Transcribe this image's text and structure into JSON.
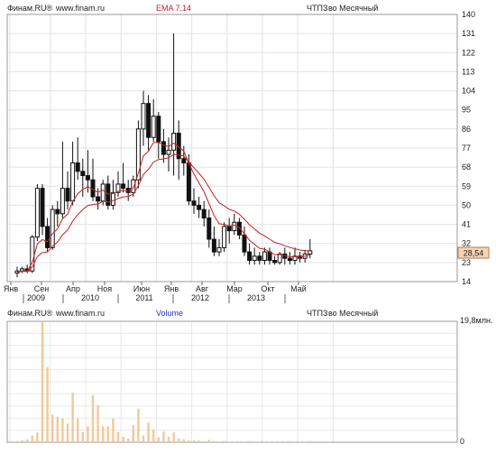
{
  "chart_data": [
    {
      "type": "candlestick",
      "header": {
        "source": "Финам.RU®",
        "site": "www.finam.ru",
        "indicator": "EMA 7,14",
        "instrument": "ЧТПЗ",
        "period": "во Месячный"
      },
      "y_axis": {
        "ticks": [
          14,
          23,
          32,
          41,
          50,
          59,
          68,
          77,
          86,
          95,
          104,
          113,
          122,
          131,
          140
        ],
        "range": [
          14,
          140
        ]
      },
      "last_price_label": "28,54",
      "x_axis": {
        "month_ticks": [
          "Янв",
          "Сен",
          "Апр",
          "Ноя",
          "Июн",
          "Янв",
          "Авг",
          "Мар",
          "Окт",
          "Май"
        ],
        "years": [
          "2009",
          "2010",
          "2011",
          "2012",
          "2013"
        ]
      },
      "series": [
        {
          "name": "ЧТПЗ",
          "ohlc": [
            [
              18,
              21,
              16,
              19
            ],
            [
              19,
              21,
              18,
              20
            ],
            [
              20,
              22,
              18,
              19
            ],
            [
              19,
              36,
              18,
              35
            ],
            [
              35,
              60,
              33,
              58
            ],
            [
              58,
              60,
              36,
              40
            ],
            [
              40,
              44,
              28,
              30
            ],
            [
              30,
              50,
              29,
              48
            ],
            [
              48,
              52,
              40,
              46
            ],
            [
              46,
              80,
              44,
              58
            ],
            [
              58,
              66,
              48,
              52
            ],
            [
              52,
              80,
              50,
              70
            ],
            [
              70,
              82,
              62,
              66
            ],
            [
              66,
              72,
              54,
              64
            ],
            [
              64,
              76,
              56,
              62
            ],
            [
              62,
              72,
              52,
              54
            ],
            [
              54,
              58,
              48,
              52
            ],
            [
              52,
              62,
              50,
              60
            ],
            [
              60,
              64,
              48,
              50
            ],
            [
              50,
              62,
              48,
              56
            ],
            [
              56,
              66,
              54,
              60
            ],
            [
              60,
              70,
              56,
              58
            ],
            [
              58,
              62,
              52,
              56
            ],
            [
              56,
              64,
              54,
              62
            ],
            [
              62,
              90,
              58,
              86
            ],
            [
              86,
              104,
              78,
              98
            ],
            [
              98,
              102,
              76,
              82
            ],
            [
              82,
              100,
              80,
              92
            ],
            [
              92,
              94,
              72,
              80
            ],
            [
              80,
              86,
              70,
              74
            ],
            [
              74,
              82,
              66,
              76
            ],
            [
              76,
              131,
              64,
              84
            ],
            [
              84,
              90,
              62,
              72
            ],
            [
              72,
              78,
              64,
              70
            ],
            [
              70,
              74,
              50,
              52
            ],
            [
              52,
              58,
              46,
              50
            ],
            [
              50,
              54,
              44,
              48
            ],
            [
              48,
              52,
              40,
              44
            ],
            [
              44,
              48,
              30,
              34
            ],
            [
              34,
              40,
              26,
              28
            ],
            [
              28,
              34,
              26,
              30
            ],
            [
              30,
              42,
              28,
              40
            ],
            [
              40,
              44,
              32,
              38
            ],
            [
              38,
              46,
              36,
              42
            ],
            [
              42,
              44,
              34,
              36
            ],
            [
              36,
              40,
              26,
              28
            ],
            [
              28,
              32,
              22,
              24
            ],
            [
              24,
              30,
              22,
              26
            ],
            [
              26,
              28,
              22,
              24
            ],
            [
              24,
              30,
              22,
              28
            ],
            [
              28,
              30,
              22,
              24
            ],
            [
              24,
              26,
              22,
              23
            ],
            [
              23,
              28,
              22,
              27
            ],
            [
              27,
              30,
              22,
              25
            ],
            [
              25,
              28,
              22,
              24
            ],
            [
              24,
              30,
              22,
              26
            ],
            [
              26,
              28,
              23,
              25
            ],
            [
              25,
              29,
              23,
              27
            ],
            [
              27,
              34,
              25,
              28.54
            ]
          ]
        },
        {
          "name": "EMA 7",
          "values": [
            18.5,
            19.0,
            19.0,
            23.0,
            31.8,
            33.8,
            32.9,
            36.6,
            38.9,
            43.7,
            45.8,
            51.8,
            55.4,
            57.5,
            58.7,
            57.5,
            56.1,
            57.1,
            55.3,
            55.5,
            56.6,
            57.0,
            56.7,
            58.1,
            65.1,
            73.3,
            75.5,
            79.6,
            79.7,
            78.3,
            77.7,
            79.3,
            77.5,
            75.6,
            69.7,
            64.8,
            60.6,
            56.4,
            50.8,
            45.1,
            41.3,
            41.0,
            40.2,
            40.7,
            39.5,
            36.6,
            33.5,
            31.6,
            29.7,
            29.3,
            28.0,
            26.7,
            26.8,
            26.3,
            25.7,
            25.8,
            25.6,
            26.0,
            26.6
          ]
        },
        {
          "name": "EMA 14",
          "values": [
            18.6,
            18.8,
            18.8,
            20.9,
            25.8,
            27.7,
            28.0,
            30.7,
            32.7,
            36.1,
            38.3,
            42.5,
            45.6,
            48.0,
            49.9,
            50.4,
            50.6,
            51.9,
            51.6,
            52.2,
            53.2,
            53.9,
            54.2,
            55.2,
            59.3,
            64.5,
            67.0,
            70.3,
            71.6,
            71.9,
            72.4,
            74.0,
            73.7,
            73.2,
            70.4,
            67.7,
            65.1,
            62.3,
            58.5,
            54.5,
            51.2,
            49.7,
            48.1,
            47.3,
            45.8,
            43.4,
            40.8,
            38.8,
            36.8,
            35.6,
            34.0,
            32.5,
            31.8,
            30.9,
            30.1,
            29.5,
            28.9,
            28.6,
            28.6
          ]
        }
      ]
    },
    {
      "type": "bar",
      "header": {
        "source": "Финам.RU®",
        "site": "www.finam.ru",
        "indicator": "Volume",
        "instrument": "ЧТПЗ",
        "period": "во Месячный"
      },
      "y_axis": {
        "ticks": [
          "19,8млн.",
          "0"
        ]
      },
      "series": [
        {
          "name": "Volume",
          "values": [
            0.2,
            0.3,
            0.5,
            1.1,
            1.6,
            19.8,
            12.3,
            4.5,
            4.2,
            3.9,
            3.1,
            8.1,
            3.9,
            1.7,
            2.6,
            7.7,
            6.1,
            2.6,
            2.6,
            3.9,
            1.7,
            0.9,
            0.6,
            2.8,
            5.5,
            1.1,
            3.2,
            2.1,
            0.8,
            1.8,
            0.9,
            1.6,
            0.6,
            0.5,
            0.3,
            0.3,
            0.3,
            0.2,
            0.4,
            0.2,
            0.1,
            0.2,
            0.1,
            0.1,
            0.1,
            0.1,
            0.2,
            0.1,
            0.1,
            0.1,
            0.1,
            0.1,
            0.1,
            0.1,
            0.2,
            0.1,
            0.1,
            0.1,
            0.2
          ]
        }
      ]
    }
  ]
}
